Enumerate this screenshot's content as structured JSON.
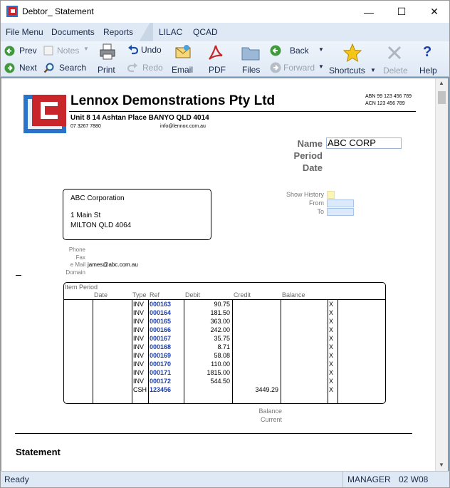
{
  "window": {
    "title": "Debtor_ Statement",
    "minimize_icon": "—",
    "maximize_icon": "☐",
    "close_icon": "✕"
  },
  "menu": [
    "File Menu",
    "Documents",
    "Reports",
    "LILAC",
    "QCAD"
  ],
  "toolbar": {
    "prev": "Prev",
    "next": "Next",
    "notes": "Notes",
    "search": "Search",
    "print": "Print",
    "undo": "Undo",
    "redo": "Redo",
    "email": "Email",
    "pdf": "PDF",
    "files": "Files",
    "back": "Back",
    "forward": "Forward",
    "shortcuts": "Shortcuts",
    "delete": "Delete",
    "help": "Help"
  },
  "company": {
    "name": "Lennox Demonstrations Pty Ltd",
    "address": "Unit 8 14 Ashtan Place BANYO QLD 4014",
    "phone": "07 3267 7880",
    "email": "info@lennox.com.au",
    "abn": "ABN 99 123 456 789",
    "acn": "ACN 123 456 789"
  },
  "fields": {
    "name_label": "Name",
    "name_value": "ABC CORP",
    "period_label": "Period",
    "date_label": "Date",
    "show_history_label": "Show History",
    "from_label": "From",
    "to_label": "To"
  },
  "customer": {
    "name": "ABC Corporation",
    "line1": "1 Main St",
    "line2": "MILTON QLD 4064",
    "phone_label": "Phone",
    "fax_label": "Fax",
    "email_label": "e Mail",
    "email_value": "james@abc.com.au",
    "domain_label": "Domain"
  },
  "table": {
    "item_period": "Item Period",
    "headers": {
      "date": "Date",
      "type": "Type",
      "ref": "Ref",
      "debit": "Debit",
      "credit": "Credit",
      "balance": "Balance"
    },
    "rows": [
      {
        "type": "INV",
        "ref": "000163",
        "debit": "90.75",
        "credit": "",
        "flag": "X"
      },
      {
        "type": "INV",
        "ref": "000164",
        "debit": "181.50",
        "credit": "",
        "flag": "X"
      },
      {
        "type": "INV",
        "ref": "000165",
        "debit": "363.00",
        "credit": "",
        "flag": "X"
      },
      {
        "type": "INV",
        "ref": "000166",
        "debit": "242.00",
        "credit": "",
        "flag": "X"
      },
      {
        "type": "INV",
        "ref": "000167",
        "debit": "35.75",
        "credit": "",
        "flag": "X"
      },
      {
        "type": "INV",
        "ref": "000168",
        "debit": "8.71",
        "credit": "",
        "flag": "X"
      },
      {
        "type": "INV",
        "ref": "000169",
        "debit": "58.08",
        "credit": "",
        "flag": "X"
      },
      {
        "type": "INV",
        "ref": "000170",
        "debit": "110.00",
        "credit": "",
        "flag": "X"
      },
      {
        "type": "INV",
        "ref": "000171",
        "debit": "1815.00",
        "credit": "",
        "flag": "X"
      },
      {
        "type": "INV",
        "ref": "000172",
        "debit": "544.50",
        "credit": "",
        "flag": "X"
      },
      {
        "type": "CSH",
        "ref": "123456",
        "debit": "",
        "credit": "3449.29",
        "flag": "X"
      }
    ],
    "balance_label": "Balance",
    "current_label": "Current"
  },
  "section_title": "Statement",
  "status": {
    "left": "Ready",
    "user": "MANAGER",
    "code": "02 W08"
  },
  "colors": {
    "menubar": "#dfe9f5",
    "doc_frame": "#7f9db9",
    "ref_blue": "#1c3fa8",
    "logo_red": "#c8262a",
    "logo_blue": "#2a73c8"
  }
}
